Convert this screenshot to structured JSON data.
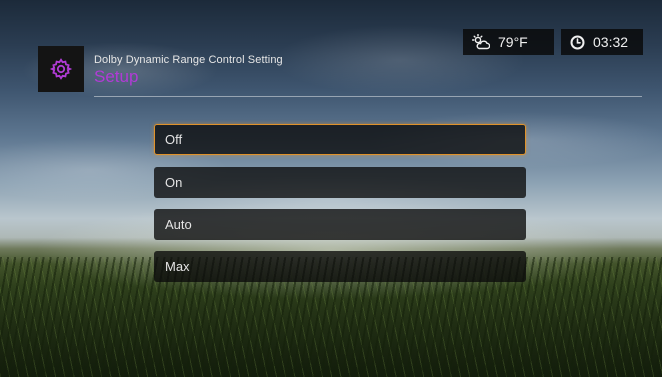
{
  "header": {
    "subtitle": "Dolby Dynamic Range Control Setting",
    "title": "Setup",
    "icon": "gear-icon",
    "accent_color": "#b13bd6"
  },
  "status": {
    "weather": {
      "icon": "partly-cloudy-icon",
      "temperature": "79°F"
    },
    "clock": {
      "icon": "clock-icon",
      "time": "03:32"
    }
  },
  "menu": {
    "selected_index": 0,
    "highlight_color": "#e0922a",
    "items": [
      {
        "label": "Off"
      },
      {
        "label": "On"
      },
      {
        "label": "Auto"
      },
      {
        "label": "Max"
      }
    ]
  }
}
